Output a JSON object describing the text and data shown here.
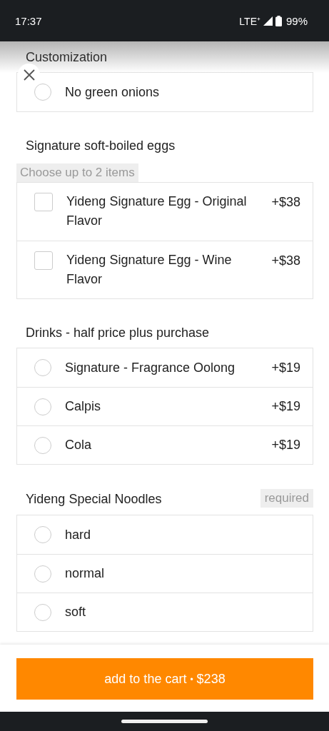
{
  "status_bar": {
    "time": "17:37",
    "network": "LTE⁺",
    "battery": "99%"
  },
  "groups": [
    {
      "title": "Customization",
      "options": [
        {
          "kind": "radio",
          "label": "No green onions",
          "checked": false
        }
      ]
    },
    {
      "title": "Signature soft-boiled eggs",
      "hint": "Choose up to 2 items",
      "options": [
        {
          "kind": "checkbox",
          "label": "Yideng Signature Egg - Original Flavor",
          "price": "+$38",
          "checked": false
        },
        {
          "kind": "checkbox",
          "label": "Yideng Signature Egg - Wine Flavor",
          "price": "+$38",
          "checked": false
        }
      ]
    },
    {
      "title": "Drinks - half price plus purchase",
      "options": [
        {
          "kind": "radio",
          "label": "Signature - Fragrance Oolong",
          "price": "+$19",
          "checked": false
        },
        {
          "kind": "radio",
          "label": "Calpis",
          "price": "+$19",
          "checked": false
        },
        {
          "kind": "radio",
          "label": "Cola",
          "price": "+$19",
          "checked": false
        }
      ]
    },
    {
      "title": "Yideng Special Noodles",
      "badge": "required",
      "options": [
        {
          "kind": "radio",
          "label": "hard",
          "checked": false
        },
        {
          "kind": "radio",
          "label": "normal",
          "checked": false
        },
        {
          "kind": "radio",
          "label": "soft",
          "checked": false
        }
      ]
    }
  ],
  "cart_button": {
    "label": "add to the cart",
    "separator": "•",
    "total": "$238"
  }
}
